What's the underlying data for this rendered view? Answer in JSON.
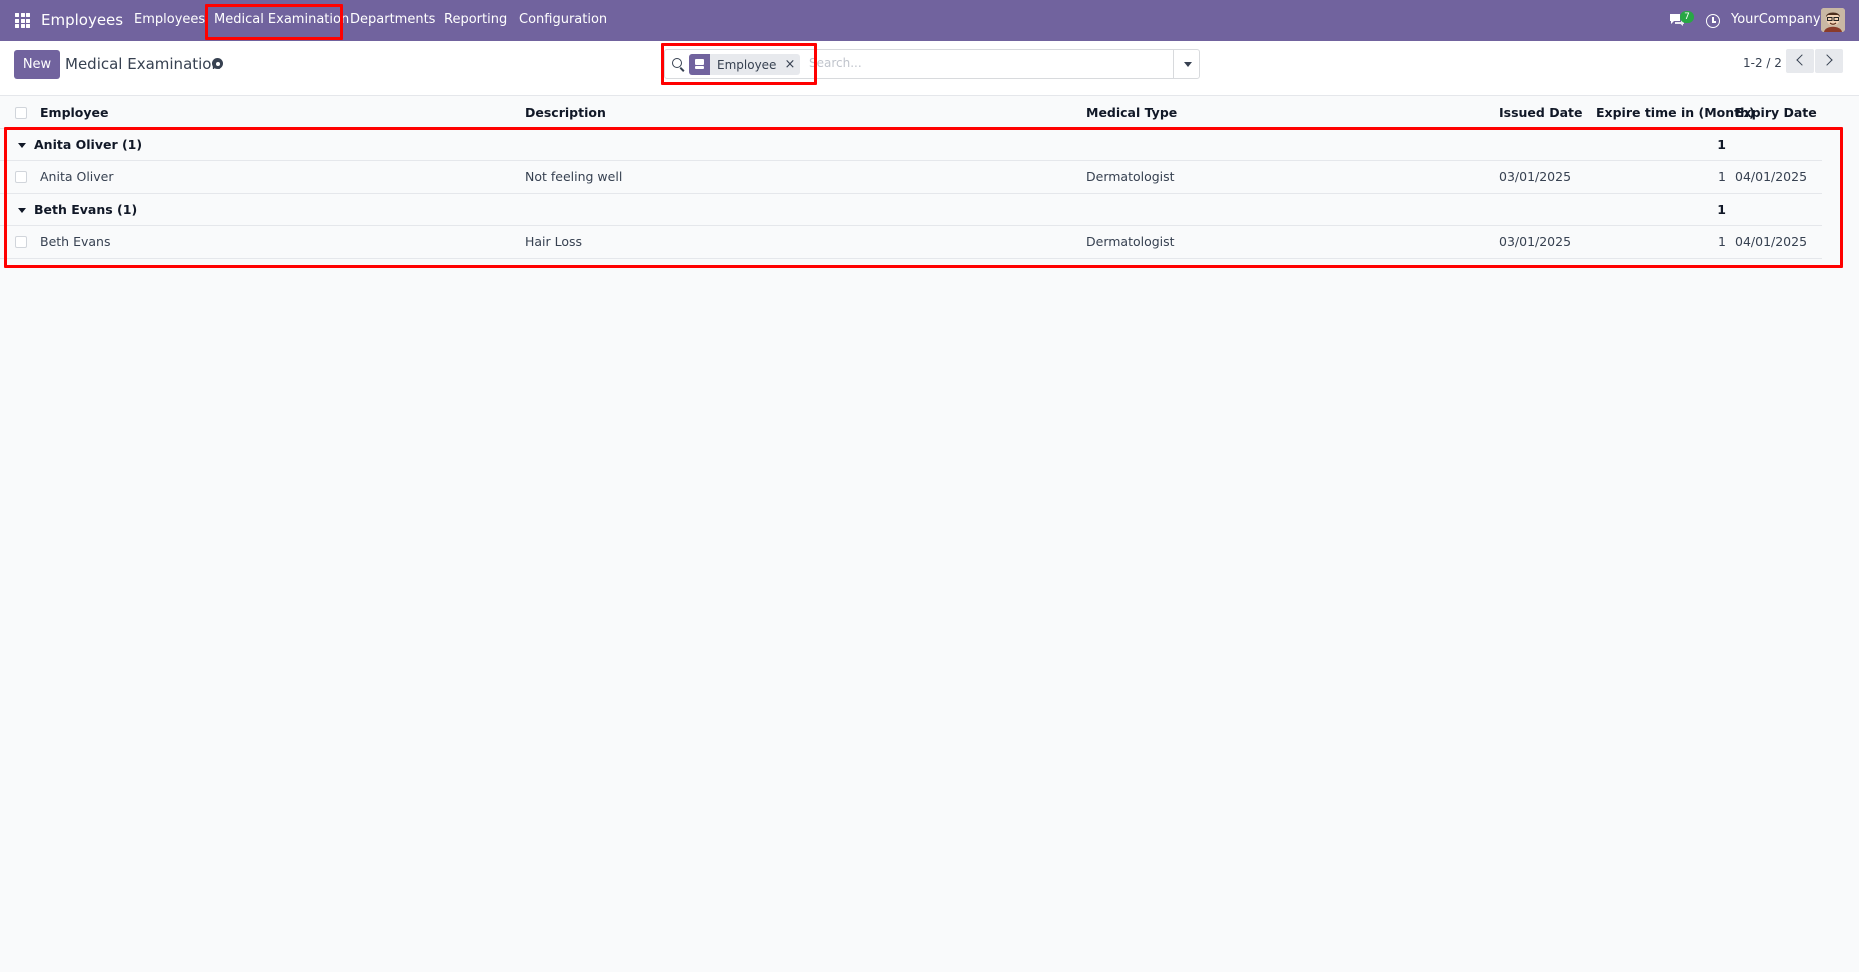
{
  "navbar": {
    "app_name": "Employees",
    "menu": [
      "Employees",
      "Medical Examination",
      "Departments",
      "Reporting",
      "Configuration"
    ],
    "chat_count": "7",
    "company": "YourCompany"
  },
  "control": {
    "new_label": "New",
    "title": "Medical Examination",
    "facet_label": "Employee",
    "facet_close": "×",
    "search_placeholder": "Search...",
    "pager": "1-2 / 2"
  },
  "table": {
    "headers": [
      "Employee",
      "Description",
      "Medical Type",
      "Issued Date",
      "Expire time in (Month)",
      "Expiry Date"
    ],
    "groups": [
      {
        "label": "Anita Oliver (1)",
        "total": "1",
        "rows": [
          {
            "employee": "Anita Oliver",
            "description": "Not feeling well",
            "medical_type": "Dermatologist",
            "issued": "03/01/2025",
            "expire_months": "1",
            "expiry": "04/01/2025"
          }
        ]
      },
      {
        "label": "Beth Evans (1)",
        "total": "1",
        "rows": [
          {
            "employee": "Beth Evans",
            "description": "Hair Loss",
            "medical_type": "Dermatologist",
            "issued": "03/01/2025",
            "expire_months": "1",
            "expiry": "04/01/2025"
          }
        ]
      }
    ]
  },
  "colors": {
    "brand": "#71639e",
    "highlight": "#ff0000",
    "badge": "#28a745"
  }
}
